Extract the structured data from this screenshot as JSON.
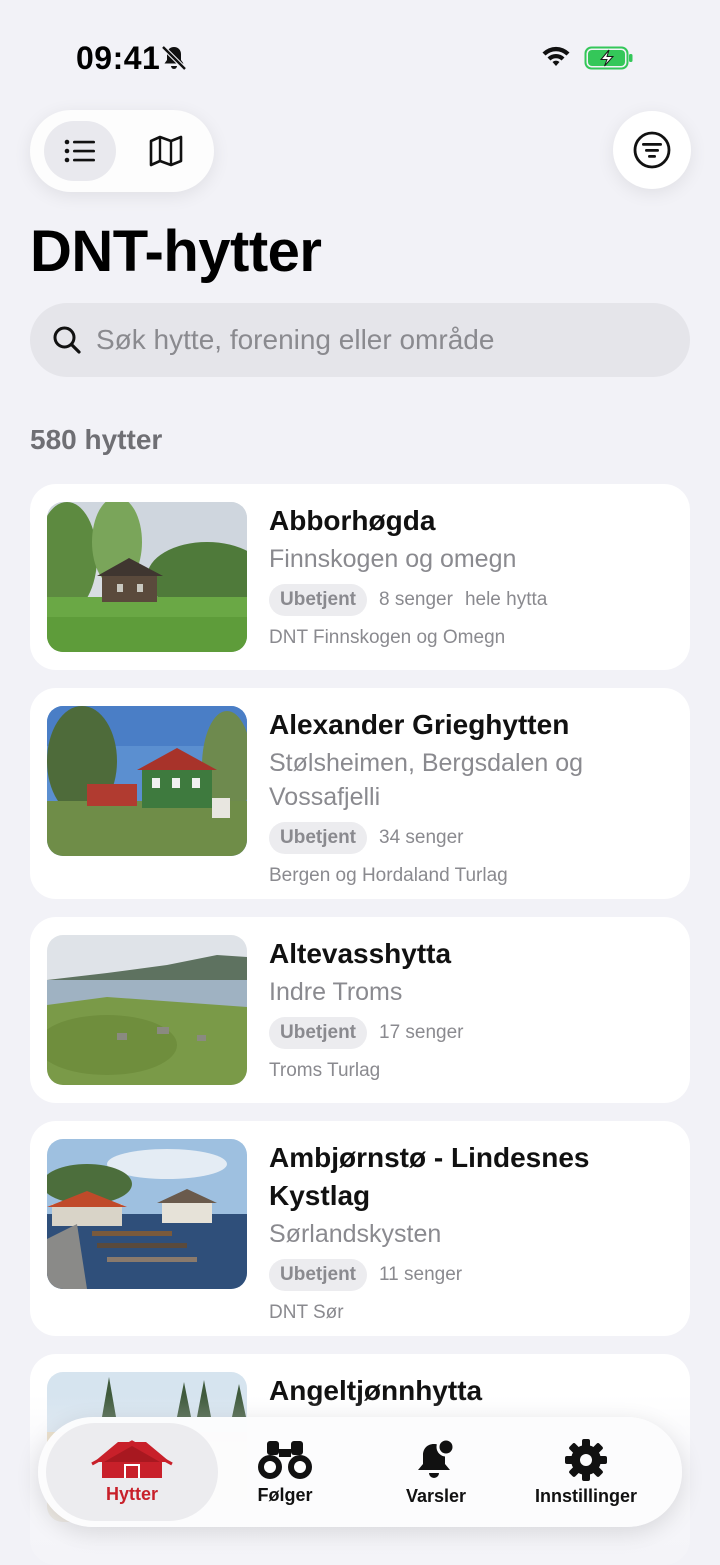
{
  "status_bar": {
    "time": "09:41",
    "icons": [
      "bell-muted-icon",
      "wifi-icon",
      "battery-charging-icon"
    ]
  },
  "toolbar": {
    "view_modes": [
      "list-icon",
      "map-icon"
    ],
    "active_view": "list",
    "filter_icon": "filter-icon"
  },
  "page": {
    "title": "DNT-hytter"
  },
  "search": {
    "placeholder": "Søk hytte, forening eller område",
    "value": ""
  },
  "results": {
    "count_label": "580 hytter"
  },
  "cabins": [
    {
      "name": "Abborhøgda",
      "area": "Finnskogen og omegn",
      "service": "Ubetjent",
      "beds": "8 senger",
      "extra": "hele hytta",
      "org": "DNT Finnskogen og Omegn"
    },
    {
      "name": "Alexander Grieghytten",
      "area": "Stølsheimen, Bergsdalen og Vossafjelli",
      "service": "Ubetjent",
      "beds": "34 senger",
      "extra": "",
      "org": "Bergen og Hordaland Turlag"
    },
    {
      "name": "Altevasshytta",
      "area": "Indre Troms",
      "service": "Ubetjent",
      "beds": "17 senger",
      "extra": "",
      "org": "Troms Turlag"
    },
    {
      "name": "Ambjørnstø - Lindesnes Kystlag",
      "area": "Sørlandskysten",
      "service": "Ubetjent",
      "beds": "11 senger",
      "extra": "",
      "org": "DNT Sør"
    },
    {
      "name": "Angeltjønnhytta",
      "area": "",
      "service": "",
      "beds": "",
      "extra": "",
      "org": ""
    }
  ],
  "tabbar": {
    "active": "Hytter",
    "tabs": [
      {
        "label": "Hytter",
        "icon": "cabin-icon"
      },
      {
        "label": "Følger",
        "icon": "binoculars-icon"
      },
      {
        "label": "Varsler",
        "icon": "bell-badge-icon"
      },
      {
        "label": "Innstillinger",
        "icon": "gear-icon"
      }
    ]
  },
  "colors": {
    "accent": "#c8202a",
    "background": "#f2f2f7",
    "battery": "#34c759"
  }
}
